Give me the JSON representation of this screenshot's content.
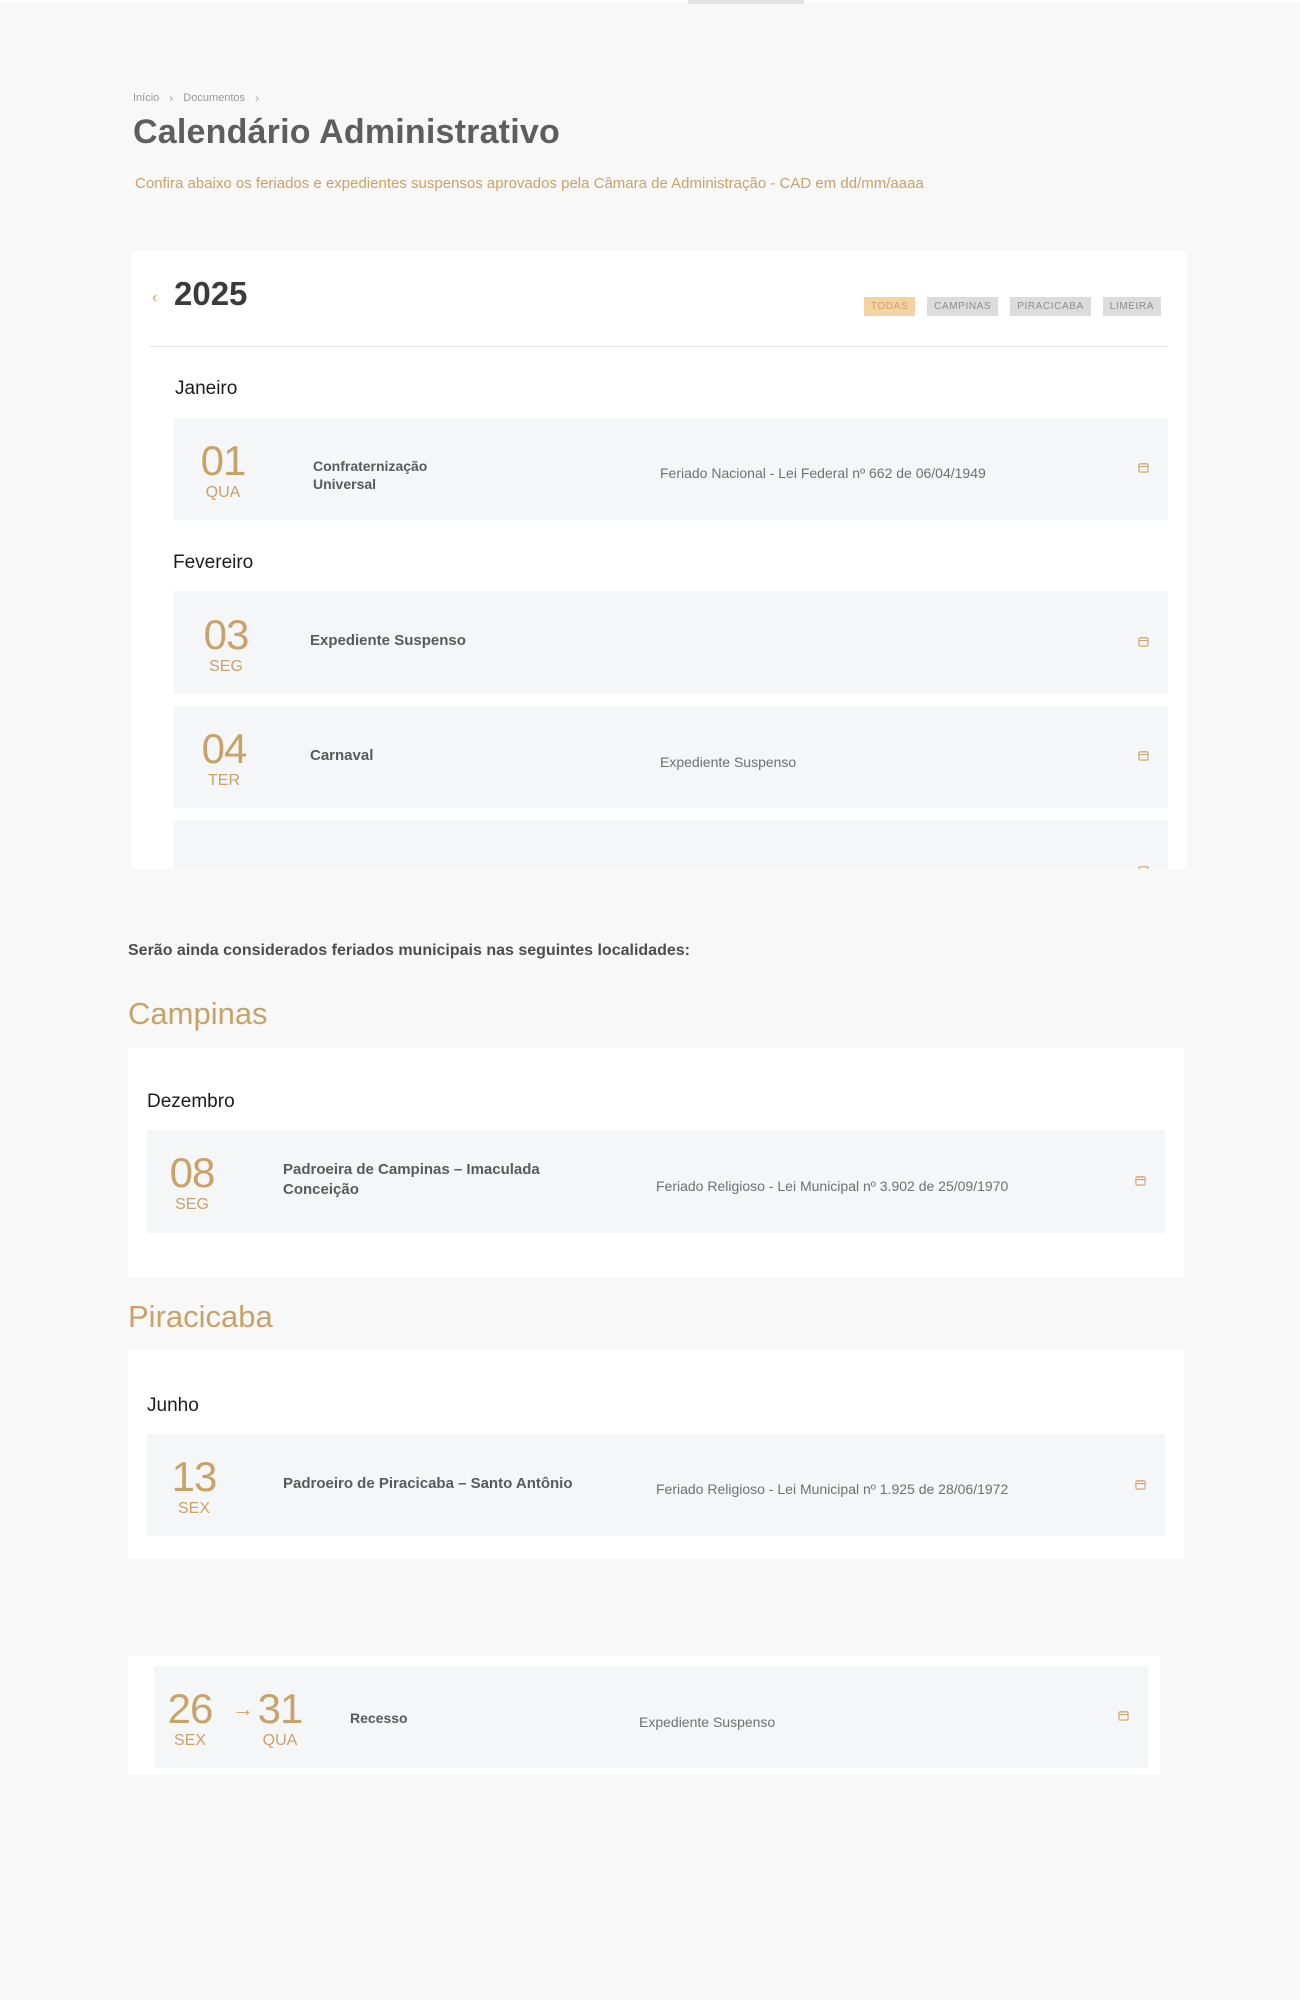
{
  "breadcrumb": {
    "home": "Início",
    "documents": "Documentos"
  },
  "page": {
    "title": "Calendário Administrativo",
    "subtitle": "Confira abaixo os feriados e expedientes suspensos aprovados pela Câmara de Administração - CAD em dd/mm/aaaa"
  },
  "calendar": {
    "prev_icon": "chevron-left-icon",
    "year": "2025",
    "filters": [
      {
        "label": "TODAS",
        "active": true
      },
      {
        "label": "CAMPINAS",
        "active": false
      },
      {
        "label": "PIRACICABA",
        "active": false
      },
      {
        "label": "LIMEIRA",
        "active": false
      }
    ],
    "months": [
      {
        "name": "Janeiro",
        "events": [
          {
            "day": "01",
            "weekday": "QUA",
            "name": "Confraternização Universal",
            "description": "Feriado Nacional - Lei Federal nº 662 de 06/04/1949",
            "icon": "calendar-add-icon"
          }
        ]
      },
      {
        "name": "Fevereiro",
        "events": [
          {
            "day": "03",
            "weekday": "SEG",
            "name": "Expediente Suspenso",
            "description": "",
            "icon": "calendar-add-icon"
          },
          {
            "day": "04",
            "weekday": "TER",
            "name": "Carnaval",
            "description": "Expediente Suspenso",
            "icon": "calendar-add-icon"
          }
        ]
      }
    ]
  },
  "municipal": {
    "note": "Serão ainda considerados feriados municipais nas seguintes localidades:",
    "cities": [
      {
        "name": "Campinas",
        "month": "Dezembro",
        "event": {
          "day": "08",
          "weekday": "SEG",
          "name": "Padroeira de Campinas – Imaculada Conceição",
          "description": "Feriado Religioso - Lei Municipal nº 3.902 de 25/09/1970",
          "icon": "calendar-add-icon"
        }
      },
      {
        "name": "Piracicaba",
        "month": "Junho",
        "event": {
          "day": "13",
          "weekday": "SEX",
          "name": "Padroeiro de Piracicaba – Santo Antônio",
          "description": "Feriado Religioso - Lei Municipal nº 1.925 de 28/06/1972",
          "icon": "calendar-add-icon"
        }
      }
    ]
  },
  "recess": {
    "start_day": "26",
    "start_weekday": "SEX",
    "arrow": "→",
    "end_day": "31",
    "end_weekday": "QUA",
    "name": "Recesso",
    "description": "Expediente Suspenso",
    "icon": "calendar-add-icon"
  },
  "colors": {
    "accent": "#c9a267",
    "row_bg": "#f5f6f8",
    "page_bg": "#f8f8f8"
  }
}
